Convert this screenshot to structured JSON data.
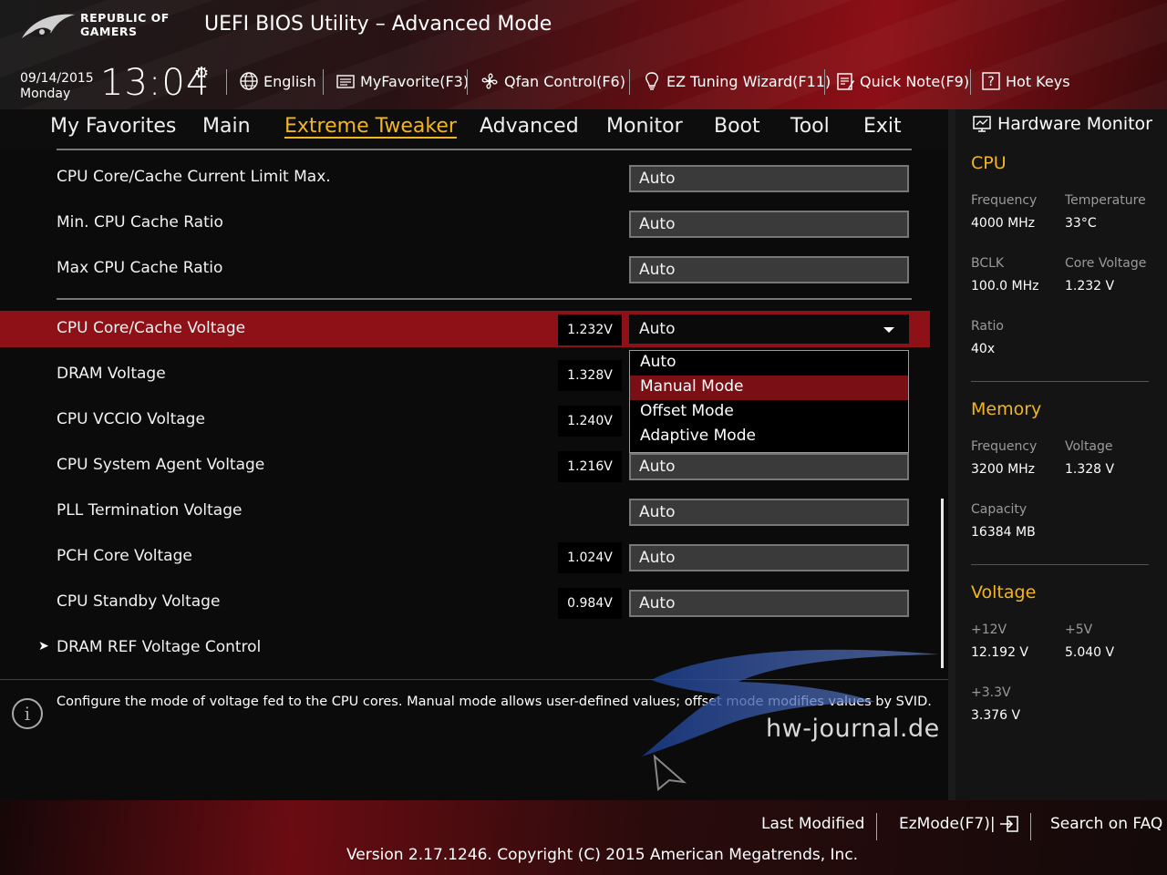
{
  "header": {
    "brand": "REPUBLIC OF GAMERS",
    "brand_line1": "REPUBLIC OF",
    "brand_line2": "GAMERS",
    "title": "UEFI BIOS Utility – Advanced Mode"
  },
  "topbar": {
    "date": "09/14/2015",
    "day": "Monday",
    "time": "13:04",
    "items": [
      {
        "label": "English",
        "icon": "globe-icon"
      },
      {
        "label": "MyFavorite(F3)",
        "icon": "favorite-icon"
      },
      {
        "label": "Qfan Control(F6)",
        "icon": "fan-icon"
      },
      {
        "label": "EZ Tuning Wizard(F11)",
        "icon": "lightbulb-icon"
      },
      {
        "label": "Quick Note(F9)",
        "icon": "note-icon"
      },
      {
        "label": "Hot Keys",
        "icon": "help-icon"
      }
    ]
  },
  "nav": {
    "tabs": [
      "My Favorites",
      "Main",
      "Extreme Tweaker",
      "Advanced",
      "Monitor",
      "Boot",
      "Tool",
      "Exit"
    ],
    "active": "Extreme Tweaker"
  },
  "settings": {
    "rows": [
      {
        "label": "CPU Core/Cache Current Limit Max.",
        "reading": "",
        "value": "Auto"
      },
      {
        "label": "Min. CPU Cache Ratio",
        "reading": "",
        "value": "Auto"
      },
      {
        "label": "Max CPU Cache Ratio",
        "reading": "",
        "value": "Auto"
      },
      {
        "label": "CPU Core/Cache Voltage",
        "reading": "1.232V",
        "value": "Auto"
      },
      {
        "label": "DRAM Voltage",
        "reading": "1.328V",
        "value": ""
      },
      {
        "label": "CPU VCCIO Voltage",
        "reading": "1.240V",
        "value": ""
      },
      {
        "label": "CPU System Agent Voltage",
        "reading": "1.216V",
        "value": "Auto"
      },
      {
        "label": "PLL Termination Voltage",
        "reading": "",
        "value": "Auto"
      },
      {
        "label": "PCH Core Voltage",
        "reading": "1.024V",
        "value": "Auto"
      },
      {
        "label": "CPU Standby Voltage",
        "reading": "0.984V",
        "value": "Auto"
      },
      {
        "label": "DRAM REF Voltage Control",
        "reading": "",
        "value": ""
      }
    ],
    "submenu_arrow": "➤",
    "dropdown": {
      "options": [
        "Auto",
        "Manual Mode",
        "Offset Mode",
        "Adaptive Mode"
      ],
      "highlighted": "Manual Mode"
    }
  },
  "help": {
    "icon": "info-icon",
    "icon_glyph": "i",
    "text": "Configure the mode of voltage fed to the CPU cores. Manual mode allows user-defined values; offset mode modifies values by SVID."
  },
  "watermark": {
    "text": "hw-journal.de"
  },
  "hardware_monitor": {
    "title": "Hardware Monitor",
    "cpu": {
      "heading": "CPU",
      "frequency_label": "Frequency",
      "frequency": "4000 MHz",
      "temperature_label": "Temperature",
      "temperature": "33°C",
      "bclk_label": "BCLK",
      "bclk": "100.0 MHz",
      "core_voltage_label": "Core Voltage",
      "core_voltage": "1.232 V",
      "ratio_label": "Ratio",
      "ratio": "40x"
    },
    "memory": {
      "heading": "Memory",
      "frequency_label": "Frequency",
      "frequency": "3200 MHz",
      "voltage_label": "Voltage",
      "voltage": "1.328 V",
      "capacity_label": "Capacity",
      "capacity": "16384 MB"
    },
    "voltage": {
      "heading": "Voltage",
      "v12_label": "+12V",
      "v12": "12.192 V",
      "v5_label": "+5V",
      "v5": "5.040 V",
      "v33_label": "+3.3V",
      "v33": "3.376 V"
    }
  },
  "footer": {
    "last_modified": "Last Modified",
    "ezmode": "EzMode(F7)|",
    "search": "Search on FAQ",
    "version": "Version 2.17.1246. Copyright (C) 2015 American Megatrends, Inc."
  },
  "colors": {
    "accent": "#f2b61e",
    "selected_row": "#8e1118",
    "dropdown_highlight": "#7a1016"
  }
}
